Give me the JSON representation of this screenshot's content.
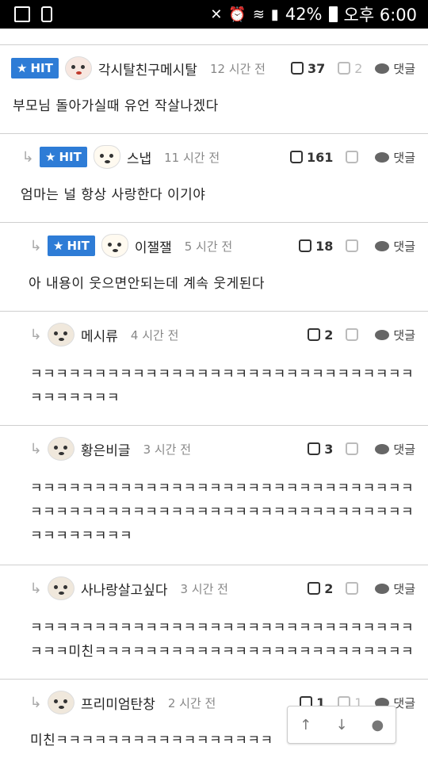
{
  "status": {
    "battery": "42%",
    "time": "오후 6:00"
  },
  "labels": {
    "hit": "HIT",
    "reply": "댓글"
  },
  "comments": [
    {
      "name": "각시탈친구메시탈",
      "time": "12 시간 전",
      "likes": "37",
      "dislikes": "2",
      "text": "부모님 돌아가실때 유언 작살나겠다"
    },
    {
      "name": "스냅",
      "time": "11 시간 전",
      "likes": "161",
      "dislikes": "",
      "text": "엄마는 널 항상 사랑한다 이기야"
    },
    {
      "name": "이잴잴",
      "time": "5 시간 전",
      "likes": "18",
      "dislikes": "",
      "text": "아 내용이 웃으면안되는데 계속 웃게된다"
    },
    {
      "name": "메시류",
      "time": "4 시간 전",
      "likes": "2",
      "dislikes": "",
      "text": "ㅋㅋㅋㅋㅋㅋㅋㅋㅋㅋㅋㅋㅋㅋㅋㅋㅋㅋㅋㅋㅋㅋㅋㅋㅋㅋㅋㅋㅋㅋㅋㅋㅋㅋㅋㅋㅋ"
    },
    {
      "name": "황은비글",
      "time": "3 시간 전",
      "likes": "3",
      "dislikes": "",
      "text": "ㅋㅋㅋㅋㅋㅋㅋㅋㅋㅋㅋㅋㅋㅋㅋㅋㅋㅋㅋㅋㅋㅋㅋㅋㅋㅋㅋㅋㅋㅋㅋㅋㅋㅋㅋㅋㅋㅋㅋㅋㅋㅋㅋㅋㅋㅋㅋㅋㅋㅋㅋㅋㅋㅋㅋㅋㅋㅋㅋㅋㅋㅋㅋㅋㅋㅋㅋㅋ"
    },
    {
      "name": "사나랑살고싶다",
      "time": "3 시간 전",
      "likes": "2",
      "dislikes": "",
      "text": "ㅋㅋㅋㅋㅋㅋㅋㅋㅋㅋㅋㅋㅋㅋㅋㅋㅋㅋㅋㅋㅋㅋㅋㅋㅋㅋㅋㅋㅋㅋㅋㅋㅋ미친ㅋㅋㅋㅋㅋㅋㅋㅋㅋㅋㅋㅋㅋㅋㅋㅋㅋㅋㅋㅋㅋㅋㅋㅋㅋ"
    },
    {
      "name": "프리미엄탄창",
      "time": "2 시간 전",
      "likes": "1",
      "dislikes": "1",
      "text": "미친ㅋㅋㅋㅋㅋㅋㅋㅋㅋㅋㅋㅋㅋㅋㅋㅋㅋ"
    }
  ],
  "accent": "#2e7cd6"
}
